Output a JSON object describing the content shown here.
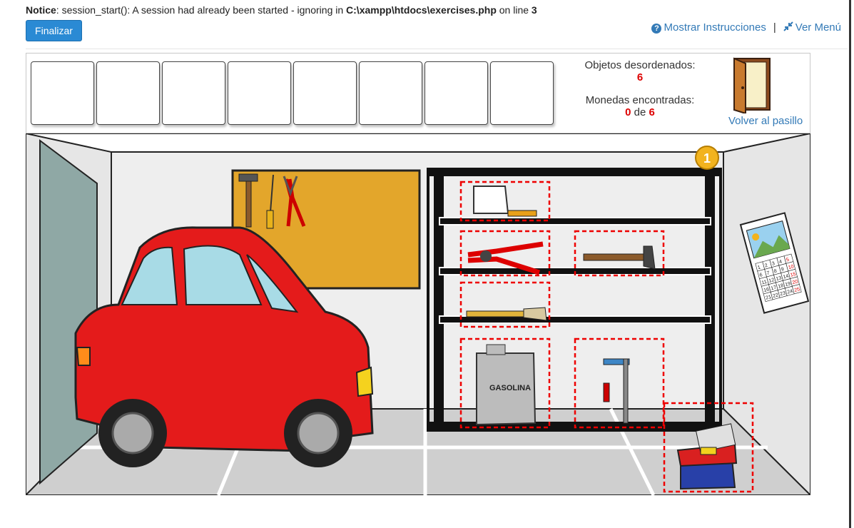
{
  "notice": {
    "label": "Notice",
    "text": "session_start(): A session had already been started - ignoring in",
    "path": "C:\\xampp\\htdocs\\exercises.php",
    "line_text": "on line",
    "line_no": "3"
  },
  "buttons": {
    "finalizar": "Finalizar"
  },
  "links": {
    "instrucciones": "Mostrar Instrucciones",
    "menu": "Ver Menú",
    "separator": "|",
    "volver": "Volver al pasillo"
  },
  "stats": {
    "desordenados_label": "Objetos desordenados:",
    "desordenados_value": "6",
    "monedas_label": "Monedas encontradas:",
    "monedas_found": "0",
    "monedas_de": "de",
    "monedas_total": "6"
  },
  "scene": {
    "gas_label": "GASOLINA",
    "coin_label": "1",
    "calendar_numbers": [
      "1",
      "2",
      "3",
      "4",
      "5",
      "6",
      "7",
      "8",
      "9",
      "10",
      "11",
      "12",
      "13",
      "14",
      "15",
      "16",
      "17",
      "18",
      "19",
      "20",
      "21",
      "22",
      "23",
      "24",
      "25"
    ]
  },
  "colors": {
    "accent": "#2a8ad4",
    "link": "#337ab7",
    "highlight": "#dd0000"
  }
}
